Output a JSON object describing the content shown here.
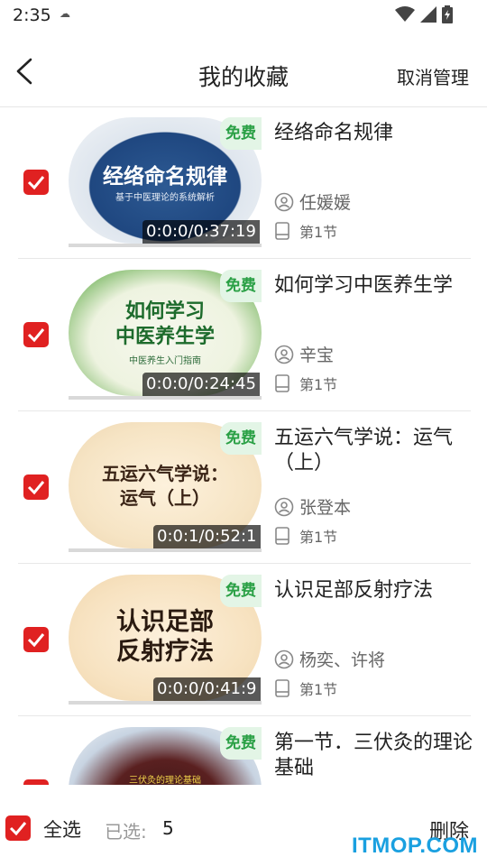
{
  "status_bar": {
    "time": "2:35"
  },
  "header": {
    "title": "我的收藏",
    "manage_label": "取消管理"
  },
  "courses": [
    {
      "title": "经络命名规律",
      "thumb_title": "经络命名规律",
      "thumb_sub": "基于中医理论的系统解析",
      "badge": "免费",
      "duration": "0:0:0/0:37:19",
      "teacher": "任媛媛",
      "section": "第1节"
    },
    {
      "title": "如何学习中医养生学",
      "thumb_title": "如何学习\n中医养生学",
      "thumb_sub": "中医养生入门指南",
      "badge": "免费",
      "duration": "0:0:0/0:24:45",
      "teacher": "辛宝",
      "section": "第1节"
    },
    {
      "title": "五运六气学说：运气（上）",
      "thumb_title": "五运六气学说：\n运气（上）",
      "thumb_sub": "",
      "badge": "免费",
      "duration": "0:0:1/0:52:1",
      "teacher": "张登本",
      "section": "第1节"
    },
    {
      "title": "认识足部反射疗法",
      "thumb_title": "认识足部\n反射疗法",
      "thumb_sub": "",
      "badge": "免费",
      "duration": "0:0:0/0:41:9",
      "teacher": "杨奕、许将",
      "section": "第1节"
    },
    {
      "title": "第一节．三伏灸的理论基础",
      "thumb_title": "",
      "thumb_sub": "三伏灸的理论基础",
      "badge": "免费",
      "duration": "",
      "teacher": "",
      "section": ""
    }
  ],
  "bottom_bar": {
    "select_all_label": "全选",
    "selected_label": "已选:",
    "selected_count": "5",
    "delete_label": "删除"
  },
  "watermark": "ITMOP.COM"
}
